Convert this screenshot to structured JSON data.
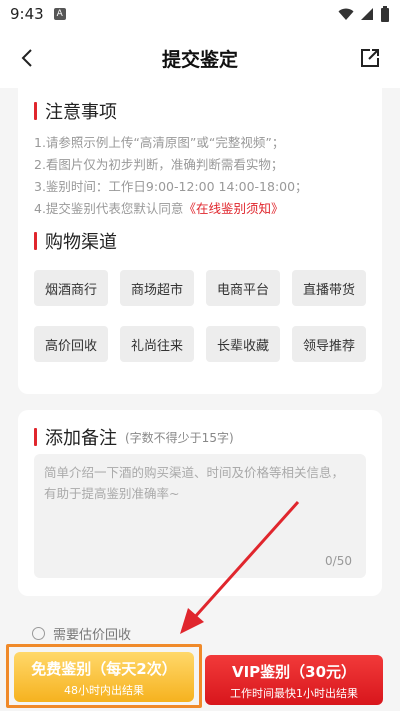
{
  "status": {
    "time": "9:43",
    "indicator": "A"
  },
  "nav": {
    "title": "提交鉴定"
  },
  "notice": {
    "title": "注意事项",
    "lines": [
      "1.请参照示例上传“高清原图”或“完整视频”；",
      "2.看图片仅为初步判断，准确判断需看实物；",
      "3.鉴别时间：工作日9:00-12:00 14:00-18:00；",
      "4.提交鉴别代表您默认同意"
    ],
    "link": "《在线鉴别须知》"
  },
  "channels": {
    "title": "购物渠道",
    "items": [
      "烟酒商行",
      "商场超市",
      "电商平台",
      "直播带货",
      "高价回收",
      "礼尚往来",
      "长辈收藏",
      "领导推荐"
    ]
  },
  "remark": {
    "title": "添加备注",
    "hint": "(字数不得少于15字)",
    "placeholder": "简单介绍一下酒的购买渠道、时间及价格等相关信息，有助于提高鉴别准确率~",
    "count": "0/50"
  },
  "recycle": {
    "label": "需要估价回收"
  },
  "buttons": {
    "free": {
      "main": "免费鉴别（每天2次）",
      "sub": "48小时内出结果"
    },
    "vip": {
      "main": "VIP鉴别（30元）",
      "sub": "工作时间最快1小时出结果"
    }
  },
  "colors": {
    "accent": "#e0262d",
    "free_button": "#f6b21f",
    "vip_button": "#d8161c"
  }
}
